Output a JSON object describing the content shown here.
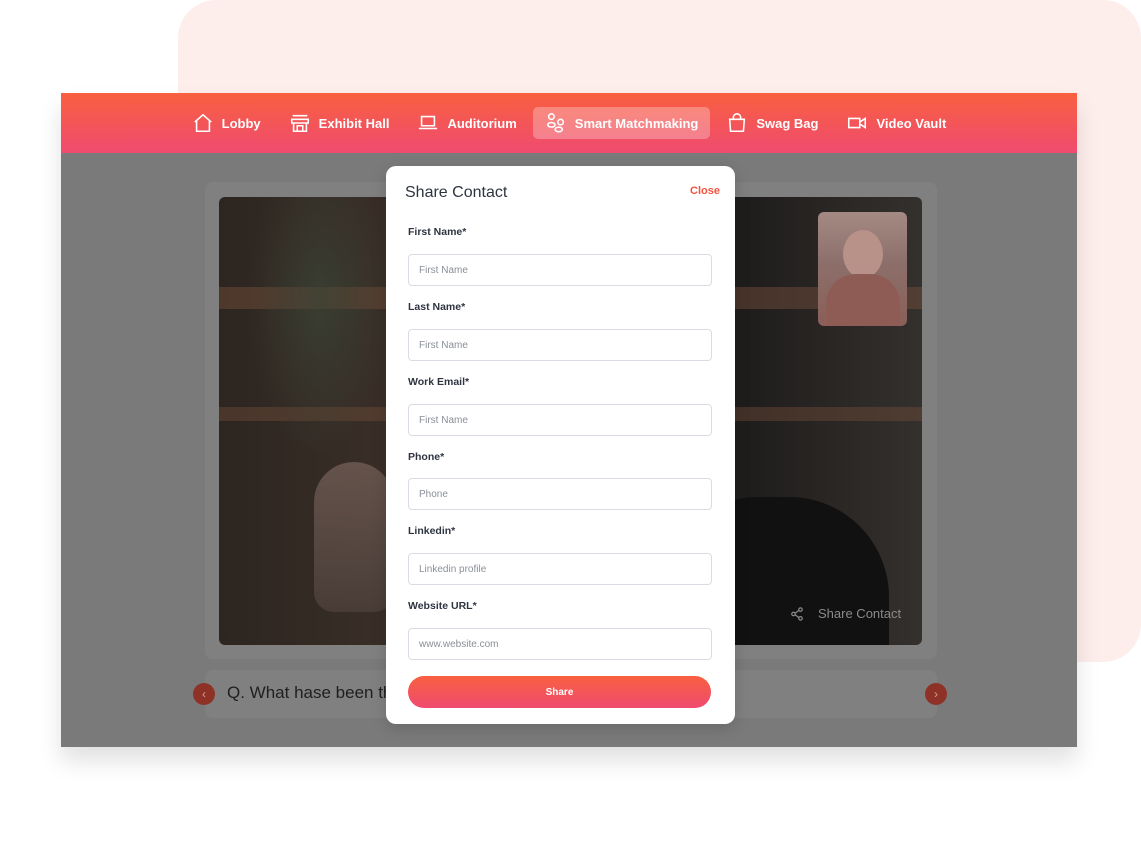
{
  "nav": {
    "items": [
      {
        "label": "Lobby",
        "icon": "home-icon",
        "active": false
      },
      {
        "label": "Exhibit Hall",
        "icon": "storefront-icon",
        "active": false
      },
      {
        "label": "Auditorium",
        "icon": "laptop-icon",
        "active": false
      },
      {
        "label": "Smart Matchmaking",
        "icon": "people-icon",
        "active": true
      },
      {
        "label": "Swag Bag",
        "icon": "shopping-bag-icon",
        "active": false
      },
      {
        "label": "Video Vault",
        "icon": "video-camera-icon",
        "active": false
      }
    ]
  },
  "video": {
    "share_contact_label": "Share Contact"
  },
  "question": {
    "text": "Q. What hase been the biggest challenge for you and your team?"
  },
  "modal": {
    "title": "Share Contact",
    "close_label": "Close",
    "fields": [
      {
        "label": "First Name*",
        "placeholder": "First Name",
        "value": ""
      },
      {
        "label": "Last Name*",
        "placeholder": "First Name",
        "value": ""
      },
      {
        "label": "Work Email*",
        "placeholder": "First Name",
        "value": ""
      },
      {
        "label": "Phone*",
        "placeholder": "Phone",
        "value": ""
      },
      {
        "label": "Linkedin*",
        "placeholder": "Linkedin profile",
        "value": ""
      },
      {
        "label": "Website URL*",
        "placeholder": "www.website.com",
        "value": ""
      }
    ],
    "submit_label": "Share"
  },
  "colors": {
    "brand_gradient_start": "#f8603f",
    "brand_gradient_end": "#ef4b70",
    "close_text": "#f0533f",
    "backdrop_card": "#fdeeeb"
  }
}
